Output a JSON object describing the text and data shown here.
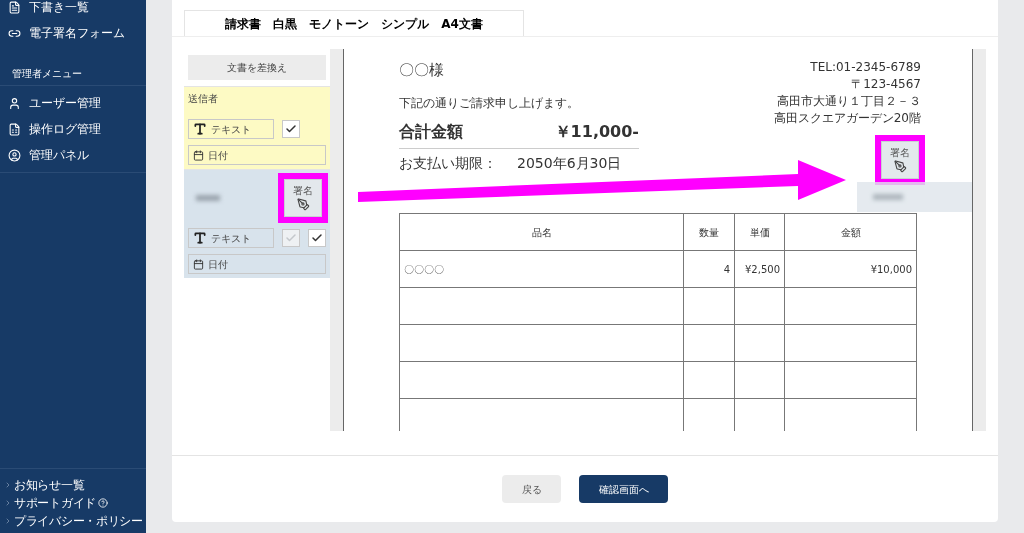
{
  "sidebar": {
    "items": [
      {
        "label": "下書き一覧"
      },
      {
        "label": "電子署名フォーム"
      }
    ],
    "admin_heading": "管理者メニュー",
    "admin_items": [
      {
        "label": "ユーザー管理"
      },
      {
        "label": "操作ログ管理"
      },
      {
        "label": "管理パネル"
      }
    ],
    "footer_links": [
      {
        "label": "お知らせ一覧",
        "help": false
      },
      {
        "label": "サポートガイド",
        "help": true
      },
      {
        "label": "プライバシー・ポリシー",
        "help": false
      }
    ]
  },
  "tab": {
    "label": "請求書　白黒　モノトーン　シンプル　A4文書",
    "selected": true
  },
  "replace_button": "文書を差換え",
  "parties": [
    {
      "kind": "sender",
      "label": "送信者",
      "text_field": "テキスト",
      "checkboxes": [
        {
          "checked": true,
          "disabled": false
        }
      ],
      "date_field": "日付"
    },
    {
      "kind": "recipient",
      "signature": "署名",
      "highlighted": true,
      "text_field": "テキスト",
      "checkboxes": [
        {
          "checked": true,
          "disabled": true
        },
        {
          "checked": true,
          "disabled": false
        }
      ],
      "date_field": "日付"
    }
  ],
  "document": {
    "recipient": "〇〇様",
    "address_lines": [
      "TEL:01-2345-6789",
      "〒123-4567",
      "高田市大通り１丁目２－３",
      "高田スクエアガーデン20階"
    ],
    "intro": "下記の通りご請求申し上げます。",
    "total_label": "合計金額",
    "total_value": "￥11,000-",
    "due_label": "お支払い期限：",
    "due_value": "2050年6月30日",
    "signature": "署名",
    "signature_highlighted": true,
    "table": {
      "columns": [
        "品名",
        "数量",
        "単価",
        "金額"
      ],
      "rows": [
        [
          "〇〇〇〇",
          "4",
          "¥2,500",
          "¥10,000"
        ],
        [
          "",
          "",
          "",
          ""
        ],
        [
          "",
          "",
          "",
          ""
        ],
        [
          "",
          "",
          "",
          ""
        ],
        [
          "",
          "",
          "",
          ""
        ]
      ]
    }
  },
  "buttons": [
    {
      "label": "戻る",
      "kind": "secondary"
    },
    {
      "label": "確認画面へ",
      "kind": "primary"
    }
  ]
}
